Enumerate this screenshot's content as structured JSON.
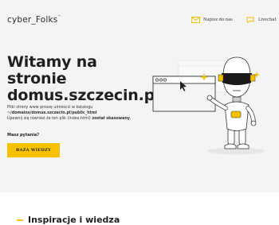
{
  "header": {
    "logo_text": "cyber_Folks",
    "logo_mark": "™",
    "contact_label": "Napisz do nas",
    "contact_icon": "mail-icon",
    "chat_label": "Livechat",
    "chat_icon": "chat-icon"
  },
  "hero": {
    "title_line1": "Witamy na",
    "title_line2": "stronie",
    "title_line3": "domus.szczecin.pl",
    "info_line1": "Pliki strony www proszę umieścić w katalogu",
    "info_path": "~/domains/domus.szczecin.pl/public_html",
    "info_line3_prefix": "Upewnij się również że ten plik (index.html) ",
    "info_line3_bold": "został skasowany",
    "info_line3_suffix": ".",
    "question": "Masz pytania?",
    "button_label": "BAZA WIEDZY"
  },
  "lower": {
    "section_title": "Inspiracje i wiedza"
  },
  "colors": {
    "accent": "#f6c200",
    "hero_bg": "#f4f4f4",
    "text": "#1f1f1f"
  }
}
